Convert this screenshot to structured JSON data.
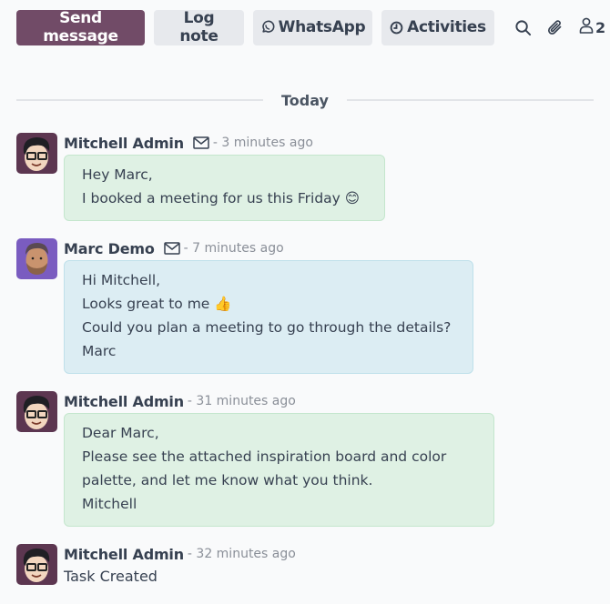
{
  "toolbar": {
    "send_message": "Send message",
    "log_note": "Log note",
    "whatsapp": "WhatsApp",
    "activities": "Activities",
    "followers_count": "2"
  },
  "icons": {
    "whatsapp": "whatsapp-icon",
    "activities": "clock-icon",
    "search": "search-icon",
    "attachments": "paperclip-icon",
    "followers": "user-icon",
    "message_type": "envelope-icon"
  },
  "colors": {
    "primary": "#714b67",
    "secondary_button": "#e7e9ed",
    "message_green": "#dff1e4",
    "message_blue": "#dcedf3",
    "date_text": "#8a8f98"
  },
  "separator": {
    "label": "Today"
  },
  "messages": [
    {
      "author": "Mitchell Admin",
      "date": "- 3 minutes ago",
      "lines": [
        "Hey Marc,",
        "I booked a meeting for us this Friday 😊"
      ]
    },
    {
      "author": "Marc Demo",
      "date": "- 7 minutes ago",
      "lines": [
        "Hi Mitchell,",
        "Looks great to me 👍",
        "Could you plan a meeting to go through the details?",
        "Marc"
      ]
    },
    {
      "author": "Mitchell Admin",
      "date": "- 31 minutes ago",
      "lines": [
        "Dear Marc,",
        "Please see the attached inspiration board and color",
        "palette, and let me know what you think.",
        "Mitchell"
      ]
    },
    {
      "author": "Mitchell Admin",
      "date": "- 32 minutes ago",
      "lines": [
        "Task Created"
      ]
    }
  ]
}
